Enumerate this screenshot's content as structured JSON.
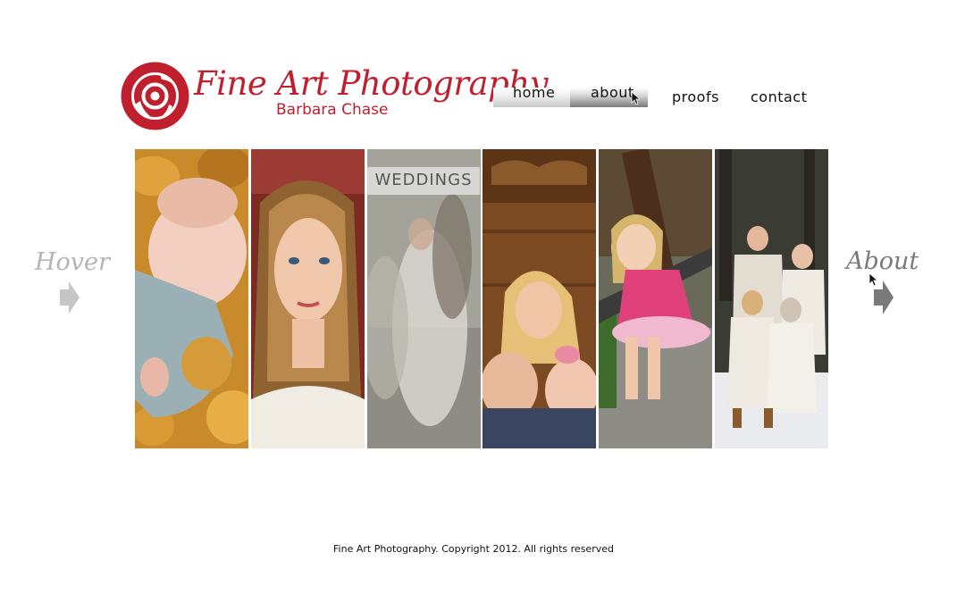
{
  "brand": {
    "title": "Fine Art Photography",
    "subtitle": "Barbara Chase",
    "color": "#c01f2e"
  },
  "nav": {
    "items": [
      {
        "label": "home"
      },
      {
        "label": "about"
      },
      {
        "label": "proofs"
      },
      {
        "label": "contact"
      }
    ]
  },
  "gallery": {
    "panels": [
      {
        "subject": "sleeping baby in autumn leaves"
      },
      {
        "subject": "portrait of young woman"
      },
      {
        "subject": "wedding couple (blurred)",
        "label": "WEDDINGS"
      },
      {
        "subject": "mother with two children on wood"
      },
      {
        "subject": "laughing girl on bench"
      },
      {
        "subject": "family portrait in snow"
      }
    ]
  },
  "left_arrow": {
    "label": "Hover",
    "icon": "arrow-right-icon"
  },
  "right_arrow": {
    "label": "About",
    "icon": "arrow-right-icon"
  },
  "footer": {
    "text": "Fine Art Photography. Copyright 2012. All rights reserved"
  }
}
